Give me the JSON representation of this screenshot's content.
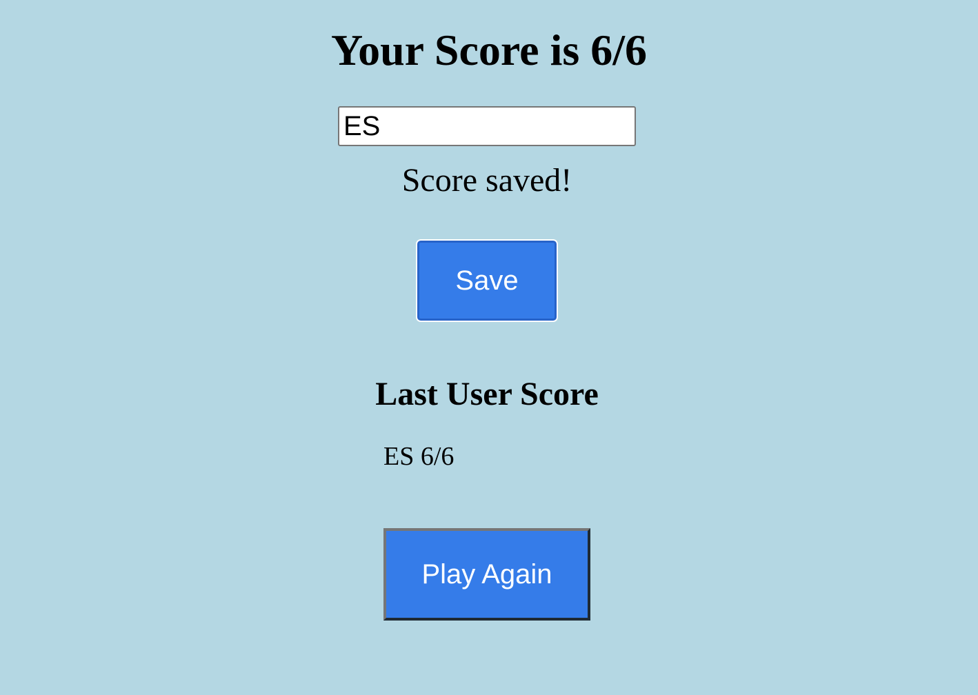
{
  "result": {
    "title": "Your Score is 6/6"
  },
  "save_form": {
    "name_value": "ES",
    "status_message": "Score saved!",
    "save_label": "Save"
  },
  "last_user": {
    "heading": "Last User Score",
    "entry": "ES 6/6"
  },
  "actions": {
    "play_again_label": "Play Again"
  },
  "colors": {
    "background": "#b4d7e3",
    "button": "#357ce9"
  }
}
